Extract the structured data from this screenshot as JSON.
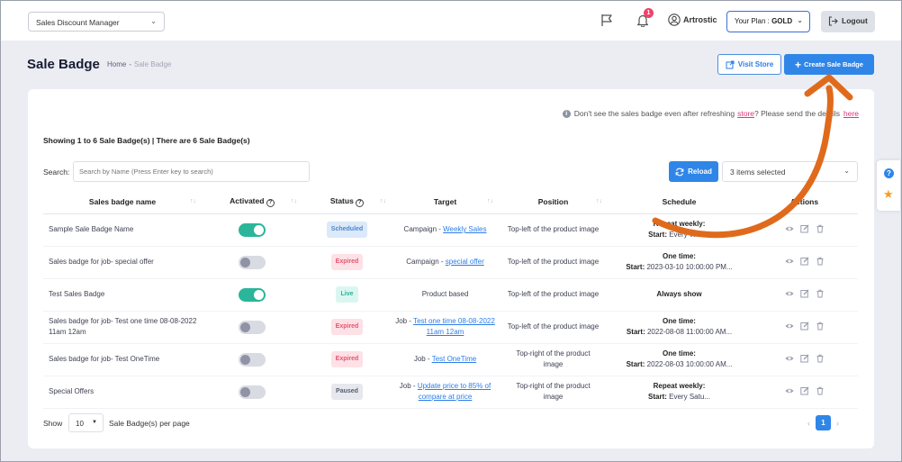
{
  "topbar": {
    "app_select": "Sales Discount Manager",
    "notification_count": "1",
    "user_name": "Artrostic",
    "plan_prefix": "Your Plan : ",
    "plan_name": "GOLD",
    "logout_label": "Logout"
  },
  "header": {
    "title": "Sale Badge",
    "breadcrumb_home": "Home",
    "breadcrumb_sep": "-",
    "breadcrumb_current": "Sale Badge",
    "visit_store_label": "Visit Store",
    "create_label": "Create Sale Badge"
  },
  "notice": {
    "text_before": "Don't see the sales badge even after refreshing",
    "store_link": "store",
    "text_after": "? Please send the details",
    "here_link": "here"
  },
  "summary": "Showing 1 to 6 Sale Badge(s) | There are 6 Sale Badge(s)",
  "search": {
    "label": "Search:",
    "placeholder": "Search by Name (Press Enter key to search)"
  },
  "reload_label": "Reload",
  "items_selected": "3 items selected",
  "columns": [
    "Sales badge name",
    "Activated",
    "Status",
    "Target",
    "Position",
    "Schedule",
    "Actions"
  ],
  "rows": [
    {
      "name": "Sample Sale Badge Name",
      "activated": true,
      "status": "Scheduled",
      "status_class": "b-scheduled",
      "target_prefix": "Campaign - ",
      "target_link": "Weekly Sales",
      "position": "Top-left of the product image",
      "sched_title": "Repeat weekly:",
      "sched_label": "Start:",
      "sched_value": " Every Wed..."
    },
    {
      "name": "Sales badge for job- special offer",
      "activated": false,
      "status": "Expired",
      "status_class": "b-expired",
      "target_prefix": "Campaign - ",
      "target_link": "special offer",
      "position": "Top-left of the product image",
      "sched_title": "One time:",
      "sched_label": "Start:",
      "sched_value": " 2023-03-10 10:00:00 PM..."
    },
    {
      "name": "Test Sales Badge",
      "activated": true,
      "status": "Live",
      "status_class": "b-live",
      "target_prefix": "Product based",
      "target_link": "",
      "position": "Top-left of the product image",
      "sched_title": "Always show",
      "sched_label": "",
      "sched_value": ""
    },
    {
      "name": "Sales badge for job- Test one time 08-08-2022 11am 12am",
      "activated": false,
      "status": "Expired",
      "status_class": "b-expired",
      "target_prefix": "Job - ",
      "target_link": "Test one time 08-08-2022 11am 12am",
      "position": "Top-left of the product image",
      "sched_title": "One time:",
      "sched_label": "Start:",
      "sched_value": " 2022-08-08 11:00:00 AM..."
    },
    {
      "name": "Sales badge for job- Test OneTime",
      "activated": false,
      "status": "Expired",
      "status_class": "b-expired",
      "target_prefix": "Job - ",
      "target_link": "Test OneTime",
      "position": "Top-right of the product image",
      "sched_title": "One time:",
      "sched_label": "Start:",
      "sched_value": " 2022-08-03 10:00:00 AM..."
    },
    {
      "name": "Special Offers",
      "activated": false,
      "status": "Paused",
      "status_class": "b-paused",
      "target_prefix": "Job - ",
      "target_link": "Update price to 85% of compare at price",
      "position": "Top-right of the product image",
      "sched_title": "Repeat weekly:",
      "sched_label": "Start:",
      "sched_value": " Every Satu..."
    }
  ],
  "footer": {
    "show_label": "Show",
    "per_page": "10",
    "per_page_label": "Sale Badge(s) per page",
    "prev": "‹",
    "current_page": "1",
    "next": "›"
  },
  "colors": {
    "primary": "#2f86e8",
    "toggle_on": "#2bb59a",
    "annotation_arrow": "#e06a1c"
  },
  "icons": [
    "flag-icon",
    "bell-icon",
    "user-icon",
    "logout-icon",
    "external-link-icon",
    "plus-icon",
    "info-icon",
    "reload-icon",
    "sort-icon",
    "help-circle-icon",
    "eye-icon",
    "edit-icon",
    "trash-icon",
    "question-icon",
    "star-icon",
    "chevron-down-icon"
  ]
}
